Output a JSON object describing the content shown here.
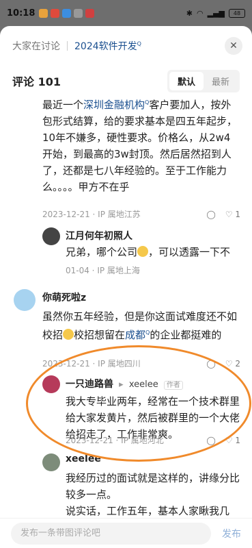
{
  "status": {
    "time": "10:18",
    "battery": "48"
  },
  "topbar": {
    "crumb": "大家在讨论",
    "topic": "2024软件开发",
    "topic_mark": "Q"
  },
  "header": {
    "title": "评论 101",
    "sort": [
      "默认",
      "最新"
    ]
  },
  "comments": [
    {
      "text_pre": "最近一个",
      "link": "深圳金融机构",
      "link_mark": "Q",
      "text_post": "客户要加人，按外包形式结算，给的要求基本是四五年起步，10年不嫌多，硬性要求。价格么，从2w4开始，到最高的3w封顶。然后居然招到人了，还都是七八年经验的。至于工作能力么。。。。甲方不在乎",
      "meta": "2023-12-21 · IP 属地江苏",
      "like_count": "1",
      "reply": {
        "user": "江月何年初照人",
        "text_pre": "兄弟，哪个公司",
        "text_post": "，可以透露一下不",
        "meta": "01-04 · IP 属地上海"
      }
    },
    {
      "user": "你萌死啦z",
      "text_pre": "虽然你五年经验，但是你这面试难度还不如校招",
      "text_mid": "校招想留在",
      "link": "成都",
      "link_mark": "Q",
      "text_post": "的企业都挺难的",
      "meta": "2023-12-21 · IP 属地四川",
      "like_count": "2",
      "replies": [
        {
          "user": "一只迪路兽",
          "to": "xeelee",
          "badge": "作者",
          "text": "我大专毕业两年，经常在一个技术群里给大家发黄片，然后被群里的一个大佬给招走了，工作非常爽。",
          "meta": "2023-12-21 · IP 属地河北",
          "like_count": "1"
        },
        {
          "user": "xeelee",
          "text": "我经历过的面试就是这样的，讲缘分比较多一点。\n说实话，工作五年，基本人家瞅我几眼，就随便放水过了。\n毕业校招，面试官是我学长，技术面就只是赶紧走"
        }
      ]
    }
  ],
  "bottom": {
    "placeholder": "发布一条带图评论吧",
    "send": "发布"
  },
  "colors": {
    "link": "#1a4f8f",
    "highlight_circle": "#f08a2b"
  }
}
